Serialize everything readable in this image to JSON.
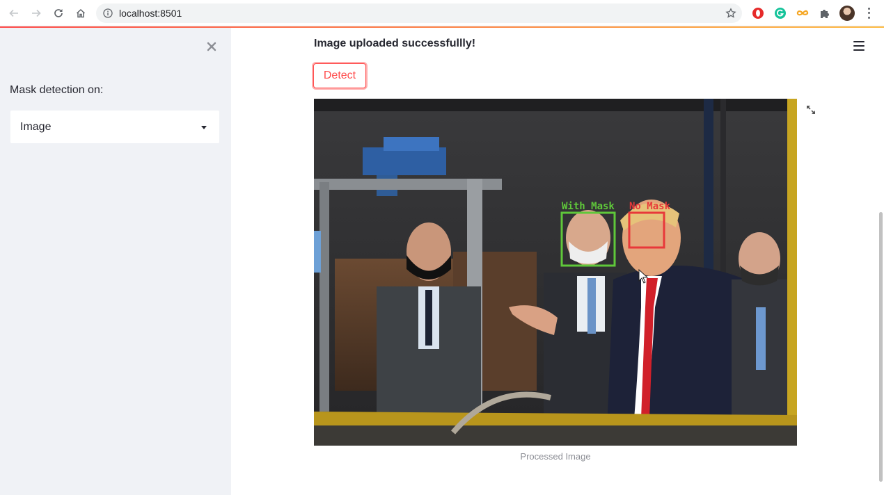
{
  "browser": {
    "url": "localhost:8501"
  },
  "sidebar": {
    "label": "Mask detection on:",
    "select_value": "Image"
  },
  "main": {
    "status_message": "Image uploaded successfullly!",
    "detect_label": "Detect",
    "caption": "Processed Image",
    "detections": [
      {
        "label": "With Mask",
        "color": "#5fc83a"
      },
      {
        "label": "No Mask",
        "color": "#e8383a"
      }
    ]
  },
  "colors": {
    "accent": "#ff4b4b",
    "sidebar_bg": "#f0f2f6"
  }
}
